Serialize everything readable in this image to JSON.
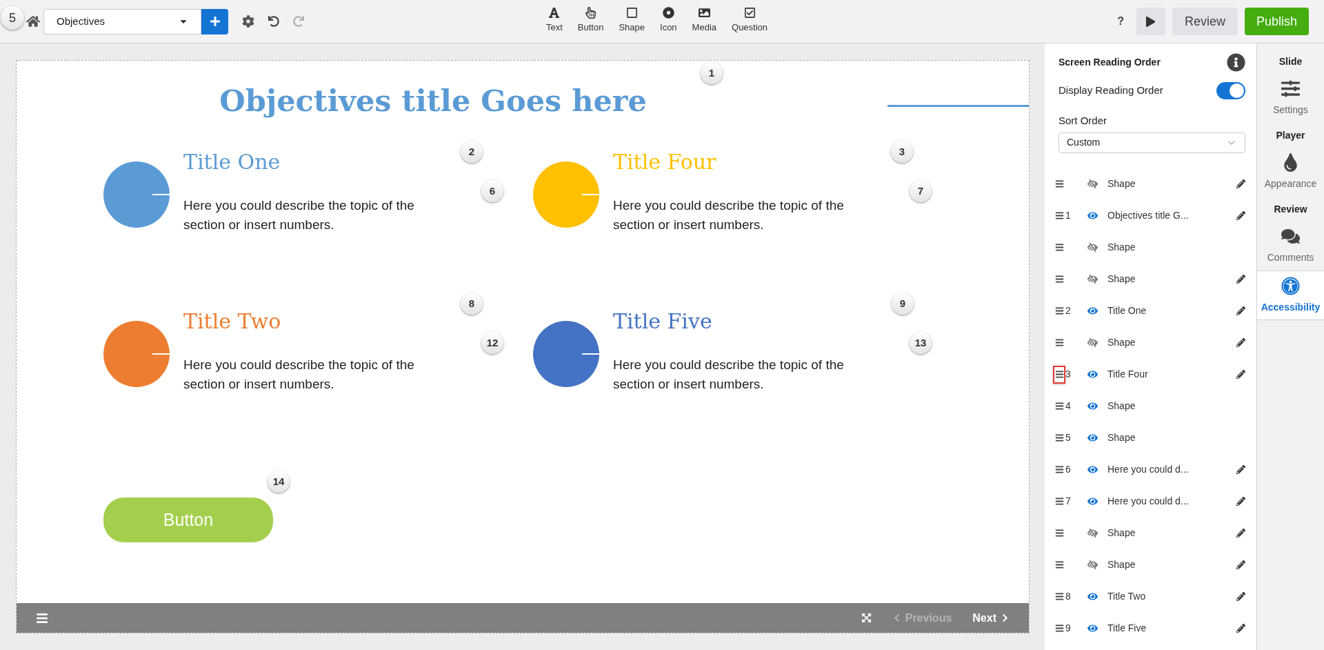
{
  "page_badge": "5",
  "toolbar": {
    "slide_select": {
      "value": "Objectives"
    },
    "tools": [
      {
        "kind": "text",
        "label": "Text"
      },
      {
        "kind": "button",
        "label": "Button"
      },
      {
        "kind": "shape",
        "label": "Shape"
      },
      {
        "kind": "icon",
        "label": "Icon"
      },
      {
        "kind": "media",
        "label": "Media"
      },
      {
        "kind": "question",
        "label": "Question"
      }
    ],
    "redo_disabled": true,
    "help": "?",
    "review_button": "Review",
    "publish_button": "Publish"
  },
  "slide": {
    "title": "Objectives title Goes here",
    "items": [
      {
        "title": "Title One",
        "color": "#5b9bd5",
        "description": "Here you could describe the topic of the section or insert numbers."
      },
      {
        "title": "Title Four",
        "color": "#ffc000",
        "description": "Here you could describe the topic of the section or insert numbers."
      },
      {
        "title": "Title Two",
        "color": "#ed7d31",
        "description": "Here you could describe the topic of the section or insert numbers."
      },
      {
        "title": "Title Five",
        "color": "#4472c4",
        "description": "Here you could describe the topic of the section or insert numbers."
      }
    ],
    "button": "Button",
    "order_badges": [
      "1",
      "2",
      "3",
      "6",
      "7",
      "8",
      "9",
      "12",
      "13",
      "14"
    ],
    "footer": {
      "previous": {
        "label": "Previous",
        "disabled": true
      },
      "next": {
        "label": "Next",
        "disabled": false
      }
    }
  },
  "reading_panel": {
    "title": "Screen Reading Order",
    "display_order": {
      "label": "Display Reading Order",
      "on": true
    },
    "sort_order": {
      "label": "Sort Order",
      "value": "Custom"
    },
    "rows": [
      {
        "label": "Shape",
        "visible": false,
        "editable": true,
        "highlighted": false
      },
      {
        "number": "1",
        "label": "Objectives title G...",
        "visible": true,
        "editable": true,
        "highlighted": false
      },
      {
        "label": "Shape",
        "visible": false,
        "editable": false,
        "highlighted": false
      },
      {
        "label": "Shape",
        "visible": false,
        "editable": true,
        "highlighted": false
      },
      {
        "number": "2",
        "label": "Title One",
        "visible": true,
        "editable": true,
        "highlighted": false
      },
      {
        "label": "Shape",
        "visible": false,
        "editable": true,
        "highlighted": false
      },
      {
        "number": "3",
        "label": "Title Four",
        "visible": true,
        "editable": true,
        "highlighted": true
      },
      {
        "number": "4",
        "label": "Shape",
        "visible": true,
        "editable": false,
        "highlighted": false
      },
      {
        "number": "5",
        "label": "Shape",
        "visible": true,
        "editable": false,
        "highlighted": false
      },
      {
        "number": "6",
        "label": "Here you could d...",
        "visible": true,
        "editable": true,
        "highlighted": false
      },
      {
        "number": "7",
        "label": "Here you could d...",
        "visible": true,
        "editable": true,
        "highlighted": false
      },
      {
        "label": "Shape",
        "visible": false,
        "editable": true,
        "highlighted": false
      },
      {
        "label": "Shape",
        "visible": false,
        "editable": true,
        "highlighted": false
      },
      {
        "number": "8",
        "label": "Title Two",
        "visible": true,
        "editable": true,
        "highlighted": false
      },
      {
        "number": "9",
        "label": "Title Five",
        "visible": true,
        "editable": true,
        "highlighted": false
      }
    ]
  },
  "nav": [
    {
      "kind": "heading",
      "label": "Slide"
    },
    {
      "kind": "item",
      "label": "Settings",
      "selected": false
    },
    {
      "kind": "heading",
      "label": "Player"
    },
    {
      "kind": "item",
      "label": "Appearance",
      "selected": false
    },
    {
      "kind": "heading",
      "label": "Review"
    },
    {
      "kind": "item",
      "label": "Comments",
      "selected": false
    },
    {
      "kind": "item",
      "label": "Accessibility",
      "selected": true
    }
  ]
}
